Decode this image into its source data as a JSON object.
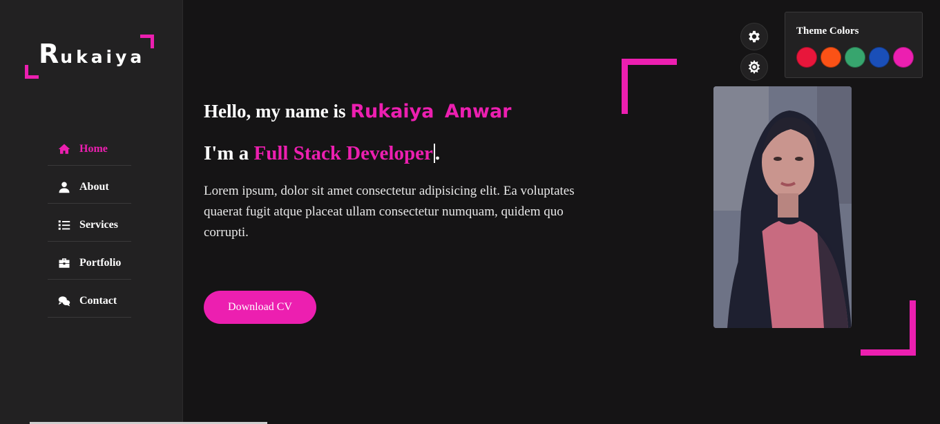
{
  "logo": {
    "first_letter": "R",
    "rest": "ukaiya"
  },
  "nav": {
    "items": [
      {
        "label": "Home",
        "icon": "home-icon",
        "active": true
      },
      {
        "label": "About",
        "icon": "user-icon",
        "active": false
      },
      {
        "label": "Services",
        "icon": "list-icon",
        "active": false
      },
      {
        "label": "Portfolio",
        "icon": "briefcase-icon",
        "active": false
      },
      {
        "label": "Contact",
        "icon": "comments-icon",
        "active": false
      }
    ]
  },
  "hero": {
    "greeting": "Hello, my name is ",
    "name": "Rukaiya Anwar",
    "role_prefix": "I'm a ",
    "profession": "Full Stack Developer",
    "role_suffix": ".",
    "description": "Lorem ipsum, dolor sit amet consectetur adipisicing elit. Ea voluptates quaerat fugit atque placeat ullam consectetur numquam, quidem quo corrupti.",
    "download_label": "Download CV"
  },
  "settings": {
    "gear_icon": "gear-icon",
    "theme_toggle_icon": "sun-icon"
  },
  "theme_panel": {
    "title": "Theme Colors",
    "colors": [
      "#e8163b",
      "#fb5216",
      "#37a56e",
      "#1a4fb8",
      "#ec1fb0"
    ]
  },
  "colors": {
    "accent": "#ec1fb0",
    "background": "#151415",
    "sidebar": "#222122"
  }
}
